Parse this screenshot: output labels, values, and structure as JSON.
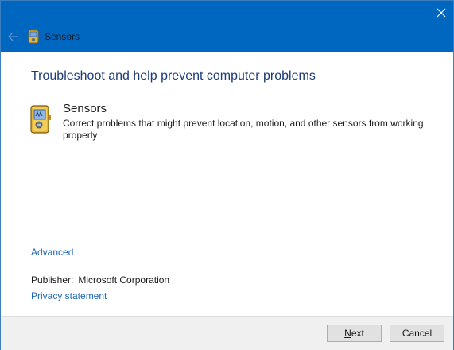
{
  "window": {
    "title": "Sensors",
    "icons": {
      "back": "back-arrow-icon",
      "close": "close-icon",
      "app": "sensors-app-icon"
    },
    "colors": {
      "titlebar": "#0067c0",
      "heading": "#1c3b78",
      "link": "#1d67b5"
    }
  },
  "main": {
    "heading": "Troubleshoot and help prevent computer problems",
    "task": {
      "title": "Sensors",
      "description": "Correct problems that might prevent location, motion, and other sensors from working properly"
    },
    "advanced_link": "Advanced",
    "publisher": {
      "label": "Publisher:",
      "value": "Microsoft Corporation"
    },
    "privacy_link": "Privacy statement"
  },
  "footer": {
    "next_label": "Next",
    "cancel_label": "Cancel"
  }
}
